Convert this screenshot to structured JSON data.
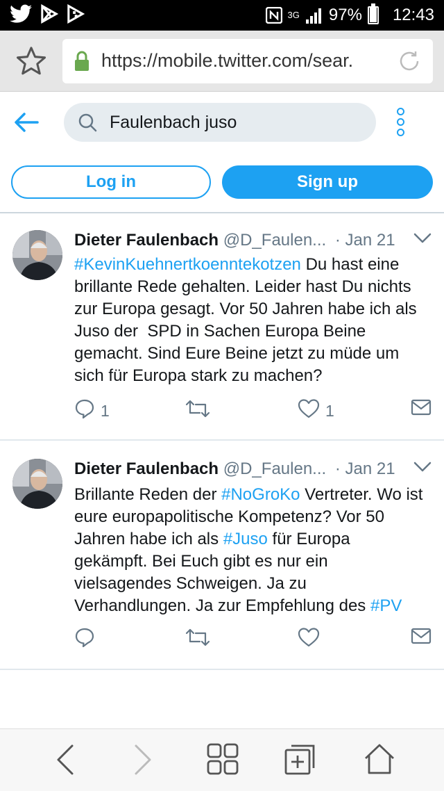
{
  "status_bar": {
    "network_type": "3G",
    "battery_percent": "97%",
    "battery_level": 0.97,
    "time": "12:43",
    "left_icons": [
      "twitter-icon",
      "play-store-icon",
      "play-games-icon"
    ],
    "right_icons": [
      "nfc-icon",
      "signal-icon",
      "battery-icon"
    ]
  },
  "browser": {
    "url": "https://mobile.twitter.com/sear.",
    "icons": [
      "star-icon",
      "lock-icon",
      "reload-icon"
    ]
  },
  "search": {
    "query": "Faulenbach juso"
  },
  "auth": {
    "login_label": "Log in",
    "signup_label": "Sign up"
  },
  "colors": {
    "accent": "#1da1f2",
    "text": "#14171a",
    "muted": "#657786"
  },
  "tweets": [
    {
      "name": "Dieter Faulenbach",
      "handle": "@D_Faulen...",
      "date": "· Jan 21",
      "body": [
        [
          {
            "t": "#KevinKuehnertkoenntekotzen",
            "hl": true
          },
          {
            "t": " Du hast eine",
            "hl": false
          }
        ],
        [
          {
            "t": "brillante Rede gehalten. Leider hast Du nichts",
            "hl": false
          }
        ],
        [
          {
            "t": "zur Europa gesagt. Vor 50 Jahren habe ich als",
            "hl": false
          }
        ],
        [
          {
            "t": "Juso der  SPD in Sachen Europa Beine",
            "hl": false
          }
        ],
        [
          {
            "t": "gemacht. Sind Eure Beine jetzt zu müde um",
            "hl": false
          }
        ],
        [
          {
            "t": "sich für Europa stark zu machen?",
            "hl": false
          }
        ]
      ],
      "replies": "1",
      "retweets": "",
      "likes": "1"
    },
    {
      "name": "Dieter Faulenbach",
      "handle": "@D_Faulen...",
      "date": "· Jan 21",
      "body": [
        [
          {
            "t": "Brillante Reden der ",
            "hl": false
          },
          {
            "t": "#NoGroKo",
            "hl": true
          },
          {
            "t": " Vertreter. Wo ist",
            "hl": false
          }
        ],
        [
          {
            "t": "eure europapolitische Kompetenz? Vor 50",
            "hl": false
          }
        ],
        [
          {
            "t": "Jahren habe ich als ",
            "hl": false
          },
          {
            "t": "#Juso",
            "hl": true
          },
          {
            "t": " für Europa",
            "hl": false
          }
        ],
        [
          {
            "t": "gekämpft. Bei Euch gibt es nur ein",
            "hl": false
          }
        ],
        [
          {
            "t": "vielsagendes Schweigen. Ja zu",
            "hl": false
          }
        ],
        [
          {
            "t": "Verhandlungen. Ja zur Empfehlung des ",
            "hl": false
          },
          {
            "t": "#PV",
            "hl": true
          }
        ]
      ],
      "replies": "",
      "retweets": "",
      "likes": ""
    }
  ],
  "bottom_nav": [
    "back-icon",
    "forward-icon",
    "tabs-grid-icon",
    "new-tab-icon",
    "home-icon"
  ]
}
